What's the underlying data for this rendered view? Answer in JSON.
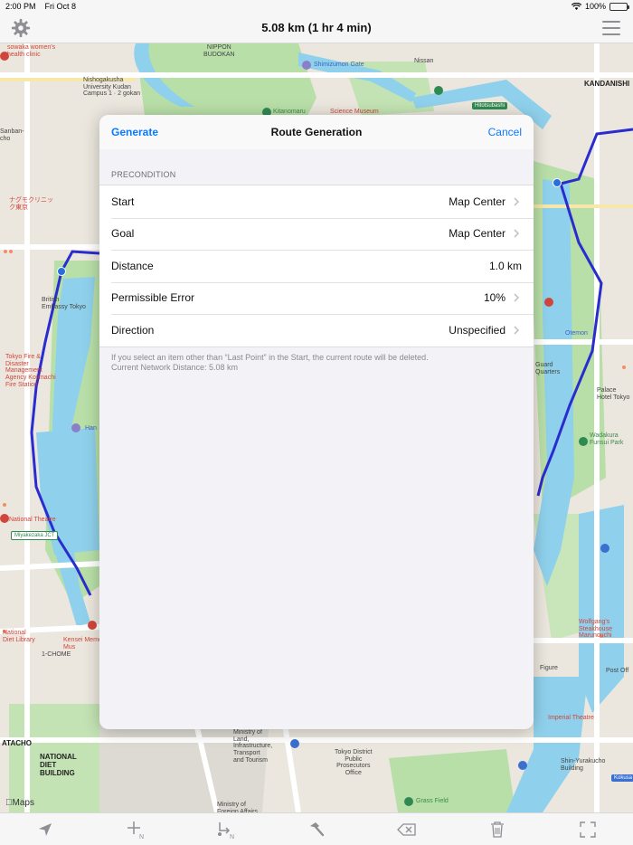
{
  "status": {
    "time": "2:00 PM",
    "date": "Fri Oct 8",
    "battery": "100%",
    "battery_level": 1.0
  },
  "nav": {
    "title": "5.08 km (1 hr 4 min)",
    "left_icon": "gear-icon",
    "right_icon": "menu-icon"
  },
  "modal": {
    "left_button": "Generate",
    "title": "Route Generation",
    "right_button": "Cancel",
    "section_header": "PRECONDITION",
    "rows": [
      {
        "label": "Start",
        "value": "Map Center",
        "chevron": true
      },
      {
        "label": "Goal",
        "value": "Map Center",
        "chevron": true
      },
      {
        "label": "Distance",
        "value": "1.0 km",
        "chevron": false
      },
      {
        "label": "Permissible Error",
        "value": "10%",
        "chevron": true
      },
      {
        "label": "Direction",
        "value": "Unspecified",
        "chevron": true
      }
    ],
    "footer_line1": "If you select an item other than “Last Point” in the Start, the current route will be deleted.",
    "footer_line2": "Current Network Distance: 5.08 km"
  },
  "map": {
    "labels": {
      "sowaka": "sowaka women's\nhealth clinic",
      "nippon_budokan": "NIPPON\nBUDOKAN",
      "shimizumon": "Shimizumon Gate",
      "nishogakusha": "Nishogakusha\nUniversity Kudan\nCampus 1 · 2 gokan",
      "nissan": "Nissan",
      "kandanishiki": "KANDANISHI",
      "kitanomaru": "Kitanomaru",
      "science_museum": "Science Museum",
      "hitotsubashi": "Hitotsubashi",
      "sanban": "Sanban-\ncho",
      "nagumo": "ナグモクリニッ\nク東京",
      "british_embassy": "British\nEmbassy Tokyo",
      "tokyo_fire": "Tokyo Fire &\nDisaster\nManagement\nAgency Kojimachi\nFire Station",
      "hanzomon": "Han",
      "otemon": "Otemon",
      "guard": "Guard\nQuarters",
      "palace_hotel": "Palace\nHotel Tokyo",
      "wadakura": "Wadakura\nFunsui Park",
      "national_theatre": "National Theatre",
      "miyakezaka": "Miyakezaka JCT",
      "national_library": "National\nDiet Library",
      "kensei": "Kensei Memor\nMus",
      "one_chome": "1-CHOME",
      "wolfgangs": "Wolfgang's\nSteakhouse\nMarunouchi",
      "figure": "Figure",
      "post_office": "Post Off",
      "imperial_theatre": "Imperial Theatre",
      "shin_yurakucho": "Shin-Yurakucho\nBuilding",
      "ministry_land": "Ministry of\nLand,\nInfrastructure,\nTransport\nand Tourism",
      "tokyo_district": "Tokyo District\nPublic\nProsecutors\nOffice",
      "grass_field": "Grass Field",
      "ministry_ag": "Ministry of\nForeign Affairs",
      "national_diet": "NATIONAL\nDIET\nBUILDING",
      "atacho": "ATACHO",
      "kokusai": "Kokusa",
      "maps_logo": "Maps"
    },
    "colors": {
      "water": "#8fd1ec",
      "park": "#b9dfa8",
      "route": "#2a2ccf",
      "road": "#ffffff",
      "block": "#e6e2d8"
    }
  },
  "toolbar": {
    "icons": [
      "location-arrow-icon",
      "add-point-icon",
      "add-segment-icon",
      "hammer-icon",
      "delete-backward-icon",
      "trash-icon",
      "fullscreen-icon"
    ]
  }
}
